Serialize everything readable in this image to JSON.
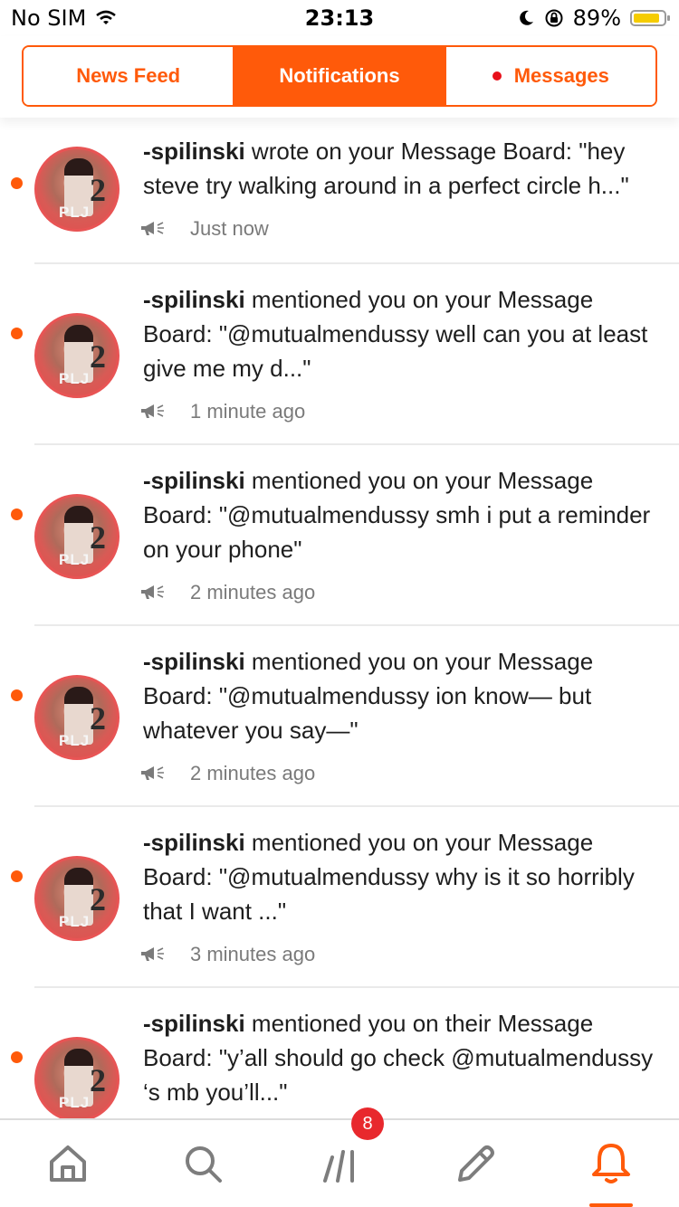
{
  "status": {
    "carrier": "No SIM",
    "time": "23:13",
    "battery": "89%",
    "battery_level": 0.89,
    "battery_color": "#f5cc00"
  },
  "tabs": [
    {
      "label": "News Feed",
      "active": false
    },
    {
      "label": "Notifications",
      "active": true
    },
    {
      "label": "Messages",
      "active": false,
      "unread": true
    }
  ],
  "accent": "#ff5a0a",
  "notifications": [
    {
      "user": "-spilinski",
      "text": " wrote on your Message Board: \"hey steve try walking around in a perfect circle h...\"",
      "time": "Just now",
      "unread": true
    },
    {
      "user": "-spilinski",
      "text": " mentioned you on your Message Board: \"@mutualmendussy well can you at least give me my d...\"",
      "time": "1 minute ago",
      "unread": true
    },
    {
      "user": "-spilinski",
      "text": " mentioned you on your Message Board: \"@mutualmendussy smh i put a reminder on your phone\"",
      "time": "2 minutes ago",
      "unread": true
    },
    {
      "user": "-spilinski",
      "text": " mentioned you on your Message Board: \"@mutualmendussy ion know— but whatever you say—\"",
      "time": "2 minutes ago",
      "unread": true
    },
    {
      "user": "-spilinski",
      "text": " mentioned you on your Message Board: \"@mutualmendussy why is it so horribly that I want ...\"",
      "time": "3 minutes ago",
      "unread": true
    },
    {
      "user": "-spilinski",
      "text": " mentioned you on their Message Board: \"y’all should go check @mutualmendussy ‘s mb you’ll...\"",
      "time": "",
      "unread": true
    }
  ],
  "avatar": {
    "number": "2",
    "caption": "PLJ"
  },
  "tabbar": {
    "items": [
      "home-icon",
      "search-icon",
      "activity-icon",
      "compose-icon",
      "bell-icon"
    ],
    "badge": "8",
    "active": "bell-icon"
  }
}
